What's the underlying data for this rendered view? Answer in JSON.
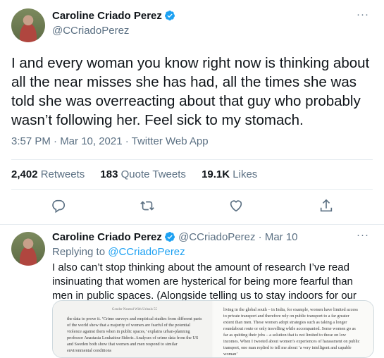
{
  "main_tweet": {
    "author_name": "Caroline Criado Perez",
    "handle": "@CCriadoPerez",
    "more_glyph": "···",
    "text": "I and every woman you know right now is thinking about all the near misses she has had, all the times she was told she was overreacting about that guy who probably wasn’t following her. Feel sick to my stomach.",
    "timestamp": "3:57 PM · Mar 10, 2021 · Twitter Web App",
    "stats": {
      "retweets_count": "2,402",
      "retweets_label": "Retweets",
      "quotes_count": "183",
      "quotes_label": "Quote Tweets",
      "likes_count": "19.1K",
      "likes_label": "Likes"
    },
    "actions": [
      "reply-icon",
      "retweet-icon",
      "like-icon",
      "share-icon"
    ]
  },
  "reply_tweet": {
    "author_name": "Caroline Criado Perez",
    "handle": "@CCriadoPerez",
    "date": "· Mar 10",
    "more_glyph": "···",
    "replying_prefix": "Replying to",
    "replying_handle": "@CCriadoPerez",
    "text": "I also can’t stop thinking about the amount of research I’ve read insinuating that women are hysterical for being more fearful than men in public spaces. (Alongside telling us to stay indoors for our own safety)",
    "media": {
      "left_header": "Gender Neutral With Urinals   55",
      "left_text": "the data to prove it. ‘Crime surveys and empirical studies from different parts of the world show that a majority of women are fearful of the potential violence against them when in public spaces,’ explains urban-planning professor Anastasia Loukaitou-Sideris. Analyses of crime data from the US and Sweden both show that women and men respond to similar environmental conditions",
      "right_text": "living in the global south – in India, for example, women have limited access to private transport and therefore rely on public transport to a far greater extent than men. These women adopt strategies such as taking a longer roundabout route or only travelling while accompanied. Some women go as far as quitting their jobs – a solution that is not limited to those on low incomes. When I tweeted about women’s experiences of harassment on public transport, one man replied to tell me about ‘a very intelligent and capable woman’"
    }
  },
  "colors": {
    "accent": "#1da1f2",
    "text": "#0f1419",
    "muted": "#5b7083",
    "divider": "#e6ecf0"
  }
}
